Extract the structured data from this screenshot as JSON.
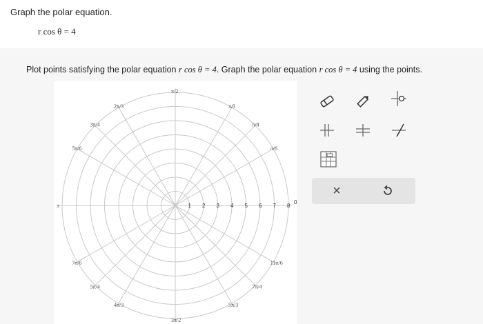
{
  "question": {
    "title": "Graph the polar equation.",
    "equation": "r cos θ = 4"
  },
  "instruction": {
    "prefix": "Plot points satisfying the polar equation ",
    "eq1": "r cos θ = 4",
    "middle": ". Graph the polar equation ",
    "eq2": "r cos θ = 4",
    "suffix": " using the points."
  },
  "polar_graph": {
    "radius_ticks": [
      "1",
      "2",
      "3",
      "4",
      "5",
      "6",
      "7",
      "8"
    ],
    "zero_label": "0",
    "angle_labels": [
      "π/6",
      "π/3",
      "π/2",
      "2π/3",
      "3π/4",
      "5π/6",
      "π",
      "7π/6",
      "5π/4",
      "4π/3",
      "3π/2",
      "5π/3",
      "7π/4",
      "11π/6",
      "π/4"
    ]
  },
  "tools": {
    "icons": [
      "eraser-icon",
      "pencil-icon",
      "point-plot-icon",
      "horizontal-line-icon",
      "vertical-line-icon",
      "slant-line-icon",
      "grid-select-icon"
    ]
  },
  "actions": {
    "clear_label": "×",
    "undo_label": "↺"
  }
}
